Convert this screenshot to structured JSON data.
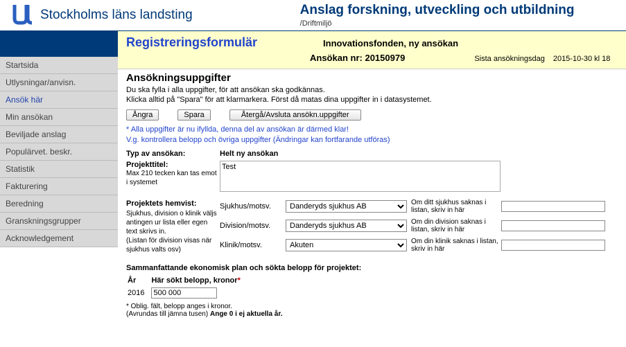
{
  "header": {
    "org": "Stockholms läns landsting",
    "app_title": "Anslag forskning, utveckling och utbildning",
    "env": "/Driftmiljö"
  },
  "nav": {
    "items": [
      {
        "label": "Startsida"
      },
      {
        "label": "Utlysningar/anvisn."
      },
      {
        "label": "Ansök här"
      },
      {
        "label": "Min ansökan"
      },
      {
        "label": "Beviljade anslag"
      },
      {
        "label": "Populärvet. beskr."
      },
      {
        "label": "Statistik"
      },
      {
        "label": "Fakturering"
      },
      {
        "label": "Beredning"
      },
      {
        "label": "Granskningsgrupper"
      },
      {
        "label": "Acknowledgement"
      }
    ],
    "active_index": 2
  },
  "yellow": {
    "title": "Registreringsformulär",
    "subtitle": "Innovationsfonden, ny ansökan",
    "appnr_label": "Ansökan nr:",
    "appnr": "20150979",
    "deadline_label": "Sista ansökningsdag",
    "deadline": "2015-10-30 kl 18"
  },
  "section": {
    "title": "Ansökningsuppgifter",
    "instr1": "Du ska fylla i alla uppgifter, för att ansökan ska godkännas.",
    "instr2": "Klicka alltid på \"Spara\" för att klarmarkera. Först då matas dina uppgifter in i datasystemet."
  },
  "buttons": {
    "undo": "Ångra",
    "save": "Spara",
    "back": "Återgå/Avsluta ansökn.uppgifter"
  },
  "status": {
    "line1": "* Alla uppgifter är nu ifyllda, denna del av ansökan är därmed klar!",
    "line2": "V.g. kontrollera belopp och övriga uppgifter (Ändringar kan fortfarande utföras)"
  },
  "fields": {
    "type_label": "Typ av ansökan:",
    "type_value": "Helt ny ansökan",
    "title_label": "Projekttitel:",
    "title_hint": "Max 210 tecken kan tas emot i systemet",
    "title_value": "Test"
  },
  "home": {
    "label": "Projektets hemvist:",
    "hint": "Sjukhus, division o klinik väljs antingen ur lista eller egen text skrivs in.\n(Listan för division visas när sjukhus valts osv)",
    "rows": [
      {
        "label": "Sjukhus/motsv.",
        "value": "Danderyds sjukhus AB",
        "hint": "Om ditt sjukhus saknas i listan, skriv in här",
        "input": ""
      },
      {
        "label": "Division/motsv.",
        "value": "Danderyds sjukhus AB",
        "hint": "Om din division saknas i listan, skriv in här",
        "input": ""
      },
      {
        "label": "Klinik/motsv.",
        "value": "Akuten",
        "hint": "Om din klinik saknas i listan, skriv in här",
        "input": ""
      }
    ]
  },
  "econ": {
    "title": "Sammanfattande ekonomisk plan och sökta belopp för projektet:",
    "col_year": "År",
    "col_amount": "Här sökt belopp, kronor",
    "year": "2016",
    "amount": "500 000",
    "note1": "* Oblig. fält, belopp anges i kronor.",
    "note2_a": "(Avrundas till jämna tusen) ",
    "note2_b": "Ange 0 i ej aktuella år."
  }
}
